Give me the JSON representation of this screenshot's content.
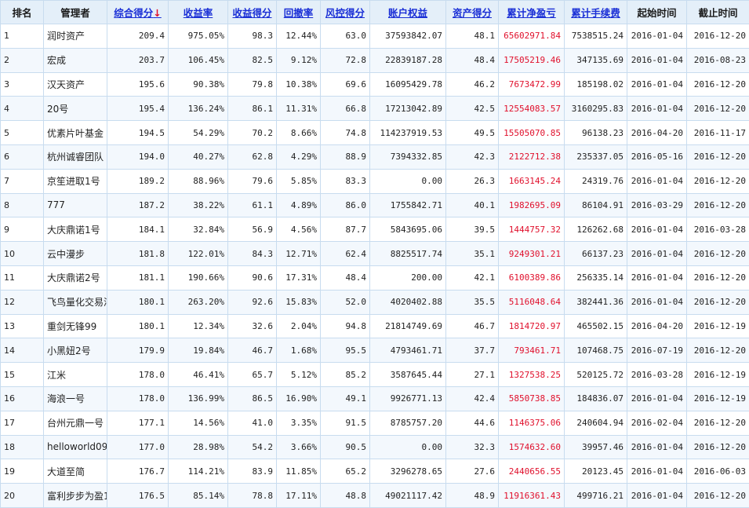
{
  "headers": {
    "rank": "排名",
    "manager": "管理者",
    "total_score": "综合得分",
    "total_score_arrow": "↓",
    "return_rate": "收益率",
    "return_score": "收益得分",
    "drawdown": "回撤率",
    "risk_score": "风控得分",
    "equity": "账户权益",
    "asset_score": "资产得分",
    "cum_pnl": "累计净盈亏",
    "cum_fee": "累计手续费",
    "start": "起始时间",
    "end": "截止时间"
  },
  "colors": {
    "pnl_text": "#e0102c",
    "link": "#1a2fd6",
    "header_bg": "#e4eff9",
    "border": "#c8dcef"
  },
  "rows": [
    {
      "rank": "1",
      "manager": "润时资产",
      "total_score": "209.4",
      "return_rate": "975.05%",
      "return_score": "98.3",
      "drawdown": "12.44%",
      "risk_score": "63.0",
      "equity": "37593842.07",
      "asset_score": "48.1",
      "cum_pnl": "65602971.84",
      "cum_fee": "7538515.24",
      "start": "2016-01-04",
      "end": "2016-12-20"
    },
    {
      "rank": "2",
      "manager": "宏成",
      "total_score": "203.7",
      "return_rate": "106.45%",
      "return_score": "82.5",
      "drawdown": "9.12%",
      "risk_score": "72.8",
      "equity": "22839187.28",
      "asset_score": "48.4",
      "cum_pnl": "17505219.46",
      "cum_fee": "347135.69",
      "start": "2016-01-04",
      "end": "2016-08-23"
    },
    {
      "rank": "3",
      "manager": "汉天资产",
      "total_score": "195.6",
      "return_rate": "90.38%",
      "return_score": "79.8",
      "drawdown": "10.38%",
      "risk_score": "69.6",
      "equity": "16095429.78",
      "asset_score": "46.2",
      "cum_pnl": "7673472.99",
      "cum_fee": "185198.02",
      "start": "2016-01-04",
      "end": "2016-12-20"
    },
    {
      "rank": "4",
      "manager": "20号",
      "total_score": "195.4",
      "return_rate": "136.24%",
      "return_score": "86.1",
      "drawdown": "11.31%",
      "risk_score": "66.8",
      "equity": "17213042.89",
      "asset_score": "42.5",
      "cum_pnl": "12554083.57",
      "cum_fee": "3160295.83",
      "start": "2016-01-04",
      "end": "2016-12-20"
    },
    {
      "rank": "5",
      "manager": "优素片叶基金",
      "total_score": "194.5",
      "return_rate": "54.29%",
      "return_score": "70.2",
      "drawdown": "8.66%",
      "risk_score": "74.8",
      "equity": "114237919.53",
      "asset_score": "49.5",
      "cum_pnl": "15505070.85",
      "cum_fee": "96138.23",
      "start": "2016-04-20",
      "end": "2016-11-17"
    },
    {
      "rank": "6",
      "manager": "杭州诚睿团队",
      "total_score": "194.0",
      "return_rate": "40.27%",
      "return_score": "62.8",
      "drawdown": "4.29%",
      "risk_score": "88.9",
      "equity": "7394332.85",
      "asset_score": "42.3",
      "cum_pnl": "2122712.38",
      "cum_fee": "235337.05",
      "start": "2016-05-16",
      "end": "2016-12-20"
    },
    {
      "rank": "7",
      "manager": "京笙进取1号",
      "total_score": "189.2",
      "return_rate": "88.96%",
      "return_score": "79.6",
      "drawdown": "5.85%",
      "risk_score": "83.3",
      "equity": "0.00",
      "asset_score": "26.3",
      "cum_pnl": "1663145.24",
      "cum_fee": "24319.76",
      "start": "2016-01-04",
      "end": "2016-12-20"
    },
    {
      "rank": "8",
      "manager": "777",
      "total_score": "187.2",
      "return_rate": "38.22%",
      "return_score": "61.1",
      "drawdown": "4.89%",
      "risk_score": "86.0",
      "equity": "1755842.71",
      "asset_score": "40.1",
      "cum_pnl": "1982695.09",
      "cum_fee": "86104.91",
      "start": "2016-03-29",
      "end": "2016-12-20"
    },
    {
      "rank": "9",
      "manager": "大庆鼎诺1号",
      "total_score": "184.1",
      "return_rate": "32.84%",
      "return_score": "56.9",
      "drawdown": "4.56%",
      "risk_score": "87.7",
      "equity": "5843695.06",
      "asset_score": "39.5",
      "cum_pnl": "1444757.32",
      "cum_fee": "126262.68",
      "start": "2016-01-04",
      "end": "2016-03-28"
    },
    {
      "rank": "10",
      "manager": "云中漫步",
      "total_score": "181.8",
      "return_rate": "122.01%",
      "return_score": "84.3",
      "drawdown": "12.71%",
      "risk_score": "62.4",
      "equity": "8825517.74",
      "asset_score": "35.1",
      "cum_pnl": "9249301.21",
      "cum_fee": "66137.23",
      "start": "2016-01-04",
      "end": "2016-12-20"
    },
    {
      "rank": "11",
      "manager": "大庆鼎诺2号",
      "total_score": "181.1",
      "return_rate": "190.66%",
      "return_score": "90.6",
      "drawdown": "17.31%",
      "risk_score": "48.4",
      "equity": "200.00",
      "asset_score": "42.1",
      "cum_pnl": "6100389.86",
      "cum_fee": "256335.14",
      "start": "2016-01-04",
      "end": "2016-12-20"
    },
    {
      "rank": "12",
      "manager": "飞鸟量化交易洋",
      "total_score": "180.1",
      "return_rate": "263.20%",
      "return_score": "92.6",
      "drawdown": "15.83%",
      "risk_score": "52.0",
      "equity": "4020402.88",
      "asset_score": "35.5",
      "cum_pnl": "5116048.64",
      "cum_fee": "382441.36",
      "start": "2016-01-04",
      "end": "2016-12-20"
    },
    {
      "rank": "13",
      "manager": "重剑无锋99",
      "total_score": "180.1",
      "return_rate": "12.34%",
      "return_score": "32.6",
      "drawdown": "2.04%",
      "risk_score": "94.8",
      "equity": "21814749.69",
      "asset_score": "46.7",
      "cum_pnl": "1814720.97",
      "cum_fee": "465502.15",
      "start": "2016-04-20",
      "end": "2016-12-19"
    },
    {
      "rank": "14",
      "manager": "小黑妞2号",
      "total_score": "179.9",
      "return_rate": "19.84%",
      "return_score": "46.7",
      "drawdown": "1.68%",
      "risk_score": "95.5",
      "equity": "4793461.71",
      "asset_score": "37.7",
      "cum_pnl": "793461.71",
      "cum_fee": "107468.75",
      "start": "2016-07-19",
      "end": "2016-12-20"
    },
    {
      "rank": "15",
      "manager": "江米",
      "total_score": "178.0",
      "return_rate": "46.41%",
      "return_score": "65.7",
      "drawdown": "5.12%",
      "risk_score": "85.2",
      "equity": "3587645.44",
      "asset_score": "27.1",
      "cum_pnl": "1327538.25",
      "cum_fee": "520125.72",
      "start": "2016-03-28",
      "end": "2016-12-19"
    },
    {
      "rank": "16",
      "manager": "海浪一号",
      "total_score": "178.0",
      "return_rate": "136.99%",
      "return_score": "86.5",
      "drawdown": "16.90%",
      "risk_score": "49.1",
      "equity": "9926771.13",
      "asset_score": "42.4",
      "cum_pnl": "5850738.85",
      "cum_fee": "184836.07",
      "start": "2016-01-04",
      "end": "2016-12-19"
    },
    {
      "rank": "17",
      "manager": "台州元鼎一号",
      "total_score": "177.1",
      "return_rate": "14.56%",
      "return_score": "41.0",
      "drawdown": "3.35%",
      "risk_score": "91.5",
      "equity": "8785757.20",
      "asset_score": "44.6",
      "cum_pnl": "1146375.06",
      "cum_fee": "240604.94",
      "start": "2016-02-04",
      "end": "2016-12-20"
    },
    {
      "rank": "18",
      "manager": "helloworld09",
      "total_score": "177.0",
      "return_rate": "28.98%",
      "return_score": "54.2",
      "drawdown": "3.66%",
      "risk_score": "90.5",
      "equity": "0.00",
      "asset_score": "32.3",
      "cum_pnl": "1574632.60",
      "cum_fee": "39957.46",
      "start": "2016-01-04",
      "end": "2016-12-20"
    },
    {
      "rank": "19",
      "manager": "大道至简",
      "total_score": "176.7",
      "return_rate": "114.21%",
      "return_score": "83.9",
      "drawdown": "11.85%",
      "risk_score": "65.2",
      "equity": "3296278.65",
      "asset_score": "27.6",
      "cum_pnl": "2440656.55",
      "cum_fee": "20123.45",
      "start": "2016-01-04",
      "end": "2016-06-03"
    },
    {
      "rank": "20",
      "manager": "富利步步为盈1·",
      "total_score": "176.5",
      "return_rate": "85.14%",
      "return_score": "78.8",
      "drawdown": "17.11%",
      "risk_score": "48.8",
      "equity": "49021117.42",
      "asset_score": "48.9",
      "cum_pnl": "11916361.43",
      "cum_fee": "499716.21",
      "start": "2016-01-04",
      "end": "2016-12-20"
    }
  ]
}
